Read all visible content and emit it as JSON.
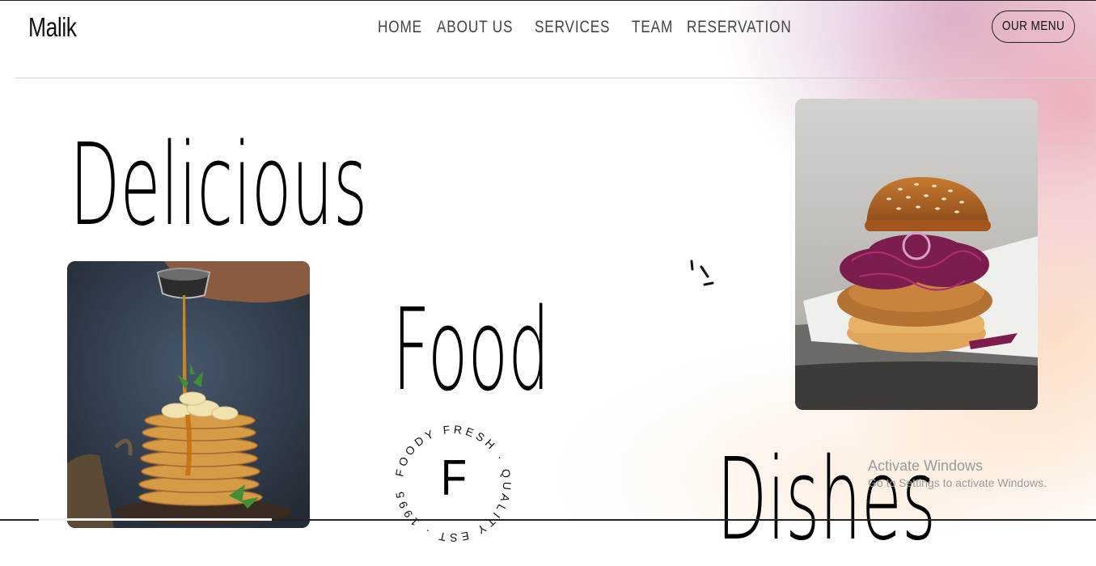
{
  "header": {
    "brand": "Malik",
    "nav": [
      "HOME",
      "ABOUT US",
      "SERVICES",
      "TEAM",
      "RESERVATION"
    ],
    "cta": "OUR MENU"
  },
  "hero": {
    "word1": "Delicious",
    "word2": "Food",
    "word3": "Dishes"
  },
  "stamp": {
    "ring_text": "FOODY FRESH · QUALITY EST · 1995 ·",
    "letter": "F"
  },
  "watermark": {
    "title": "Activate Windows",
    "subtitle": "Go to Settings to activate Windows."
  },
  "colors": {
    "text": "#000000",
    "nav": "#444444",
    "glow_pink": "#e9a0aa",
    "glow_peach": "#f9c8a0"
  }
}
